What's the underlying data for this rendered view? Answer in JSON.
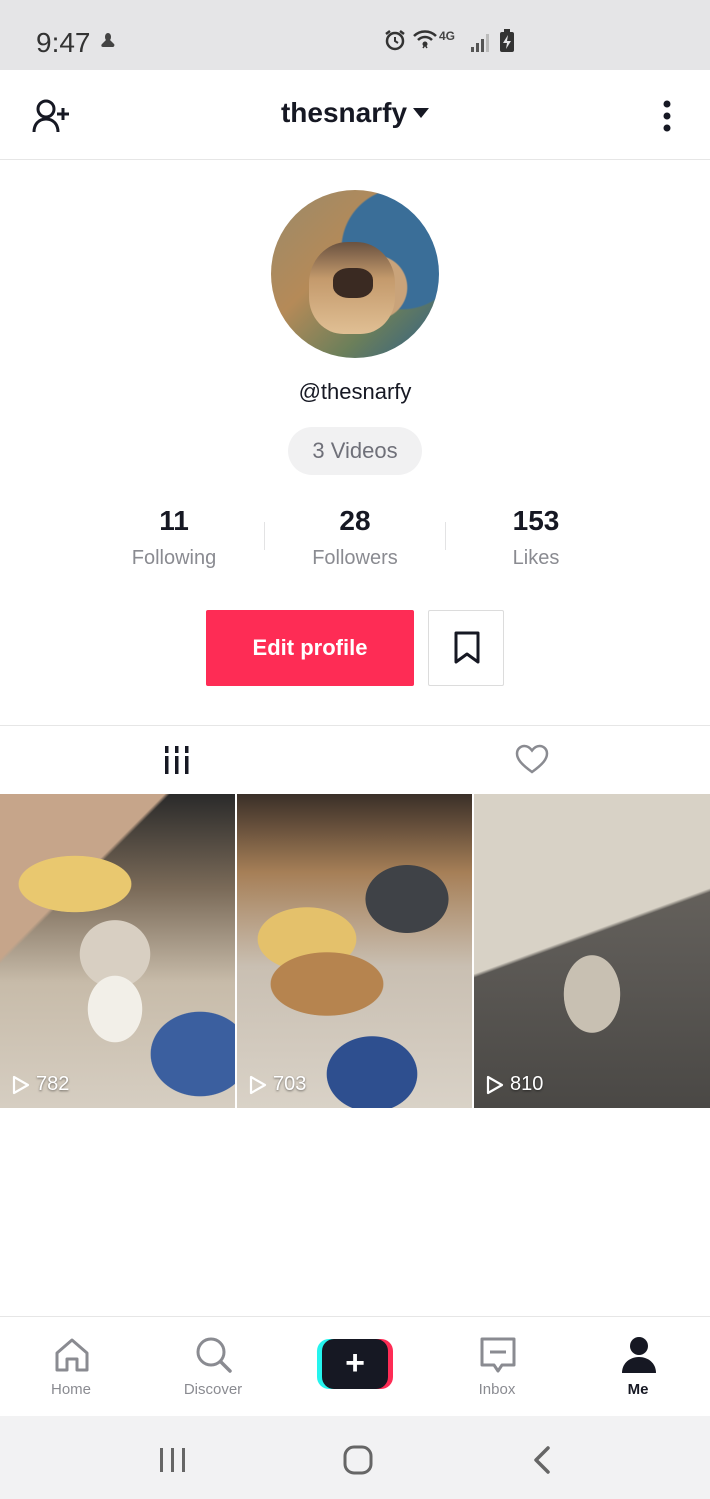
{
  "status_bar": {
    "time": "9:47",
    "network_label": "4G",
    "icons": [
      "pokemon-icon",
      "alarm-icon",
      "wifi-icon",
      "signal-icon",
      "battery-icon"
    ]
  },
  "header": {
    "title": "thesnarfy",
    "icons": {
      "left": "add-friend-icon",
      "right": "more-icon",
      "title_caret": "caret-down-icon"
    }
  },
  "profile": {
    "handle": "@thesnarfy",
    "videos_pill": "3 Videos",
    "stats": [
      {
        "value": "11",
        "label": "Following"
      },
      {
        "value": "28",
        "label": "Followers"
      },
      {
        "value": "153",
        "label": "Likes"
      }
    ],
    "edit_button": "Edit profile",
    "bookmark_icon": "bookmark-icon"
  },
  "tabs": [
    {
      "icon": "grid-videos-icon",
      "active": true
    },
    {
      "icon": "heart-icon",
      "active": false
    }
  ],
  "videos": [
    {
      "views": "782"
    },
    {
      "views": "703"
    },
    {
      "views": "810"
    }
  ],
  "bottom_nav": [
    {
      "label": "Home",
      "icon": "home-icon"
    },
    {
      "label": "Discover",
      "icon": "search-icon"
    },
    {
      "label": "",
      "icon": "plus-icon"
    },
    {
      "label": "Inbox",
      "icon": "inbox-icon"
    },
    {
      "label": "Me",
      "icon": "profile-icon",
      "active": true
    }
  ],
  "android_nav": [
    "recents-icon",
    "home-circle-icon",
    "back-icon"
  ],
  "colors": {
    "accent": "#fe2c55",
    "cyan": "#25f4ee",
    "text": "#161823",
    "muted": "#8a8b91"
  }
}
